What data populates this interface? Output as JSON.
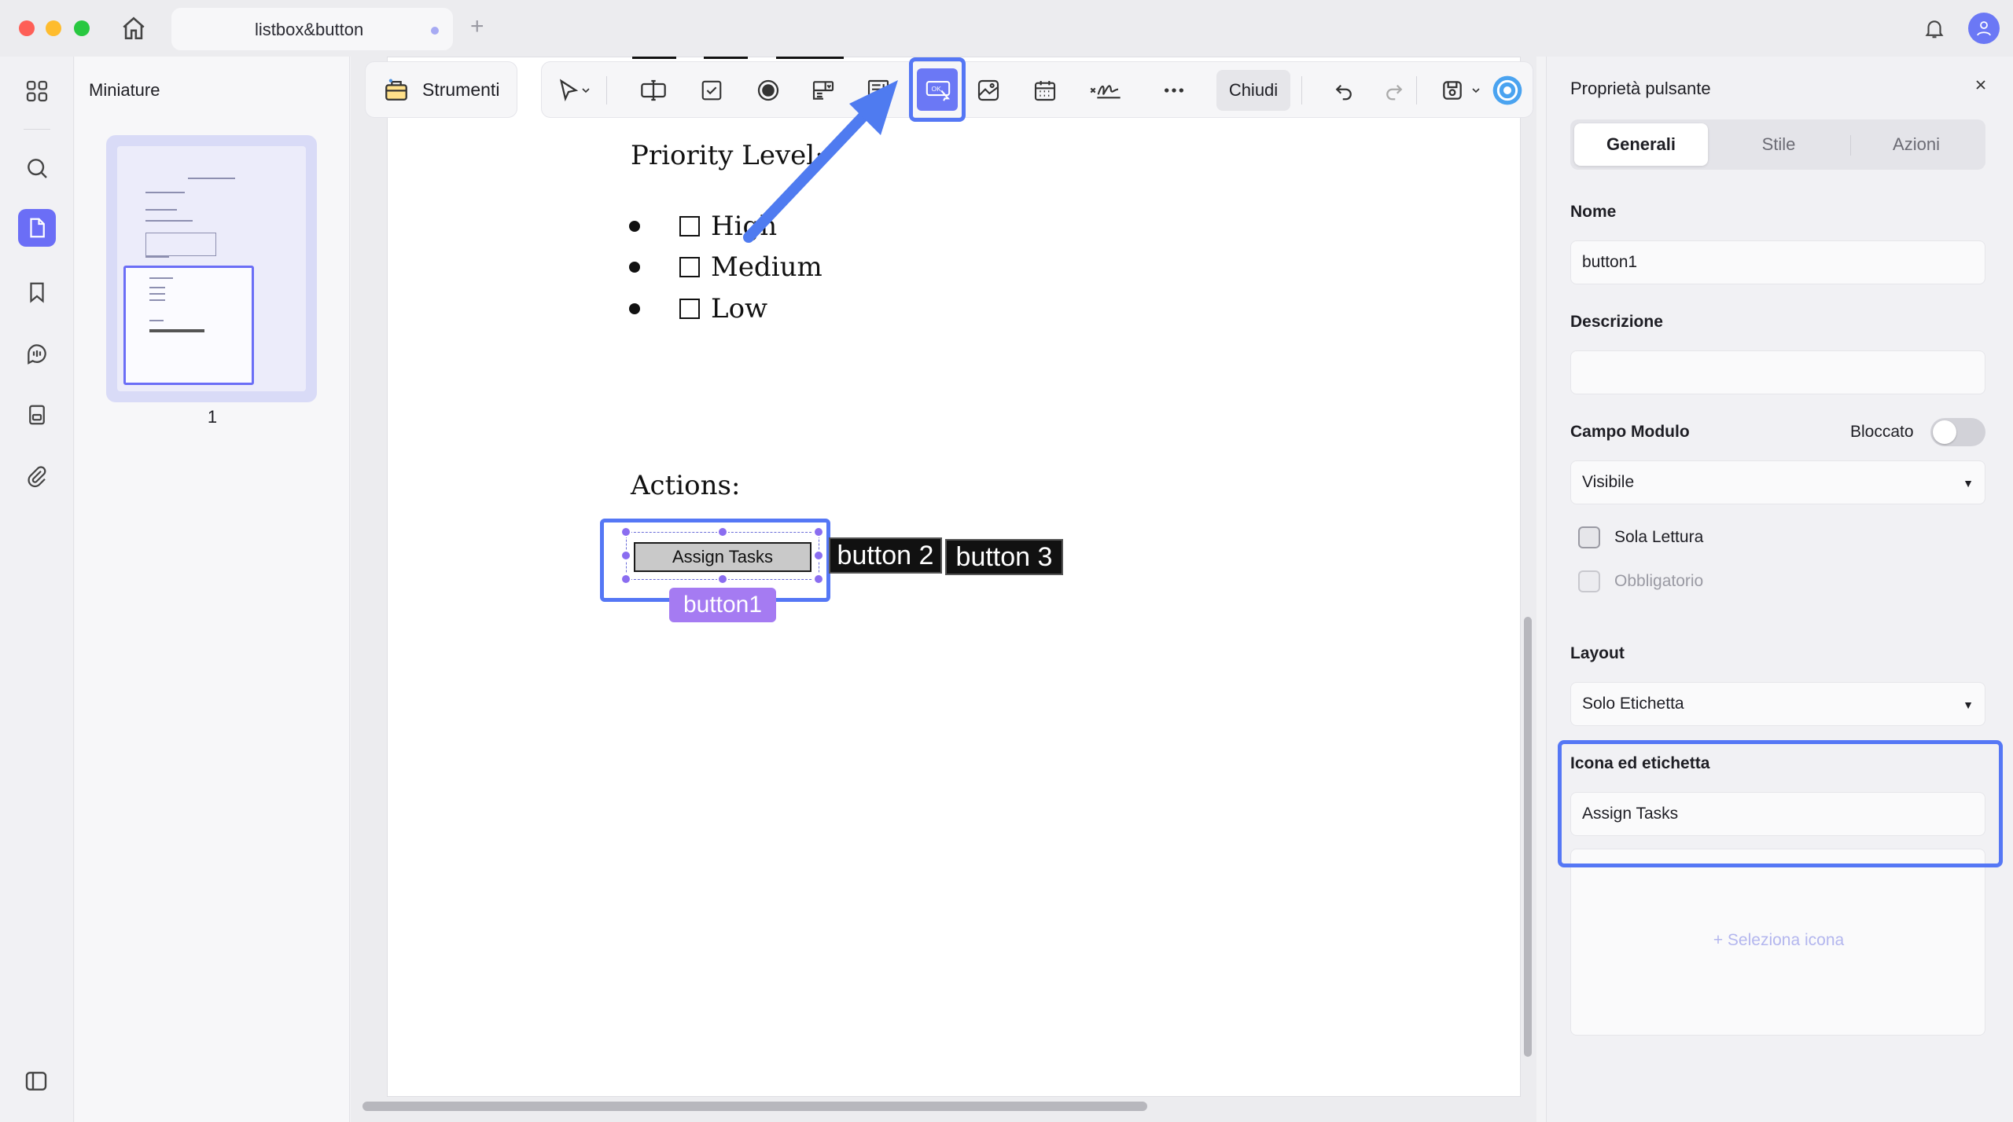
{
  "window": {
    "tab_title": "listbox&button",
    "tab_add": "+"
  },
  "sidebar": {
    "title": "Miniature",
    "page_number": "1"
  },
  "toolbar": {
    "tools_label": "Strumenti",
    "close_label": "Chiudi"
  },
  "document": {
    "priority_title": "Priority Level:",
    "priority_items": [
      "High",
      "Medium",
      "Low"
    ],
    "actions_title": "Actions:",
    "buttons": {
      "assign": "Assign Tasks",
      "button1_tag": "button1",
      "button2": "button 2",
      "button3": "button 3"
    }
  },
  "properties": {
    "title": "Proprietà pulsante",
    "tabs": [
      "Generali",
      "Stile",
      "Azioni"
    ],
    "name_label": "Nome",
    "name_value": "button1",
    "description_label": "Descrizione",
    "description_value": "",
    "form_field_label": "Campo Modulo",
    "locked_label": "Bloccato",
    "visibility_value": "Visibile",
    "readonly_label": "Sola Lettura",
    "required_label": "Obbligatorio",
    "layout_label": "Layout",
    "layout_value": "Solo Etichetta",
    "icon_label_title": "Icona ed etichetta",
    "label_value": "Assign Tasks",
    "select_icon": "+ Seleziona icona"
  },
  "colors": {
    "accent": "#6b6ef6",
    "highlight": "#5577f5",
    "tag": "#a57bf2"
  }
}
